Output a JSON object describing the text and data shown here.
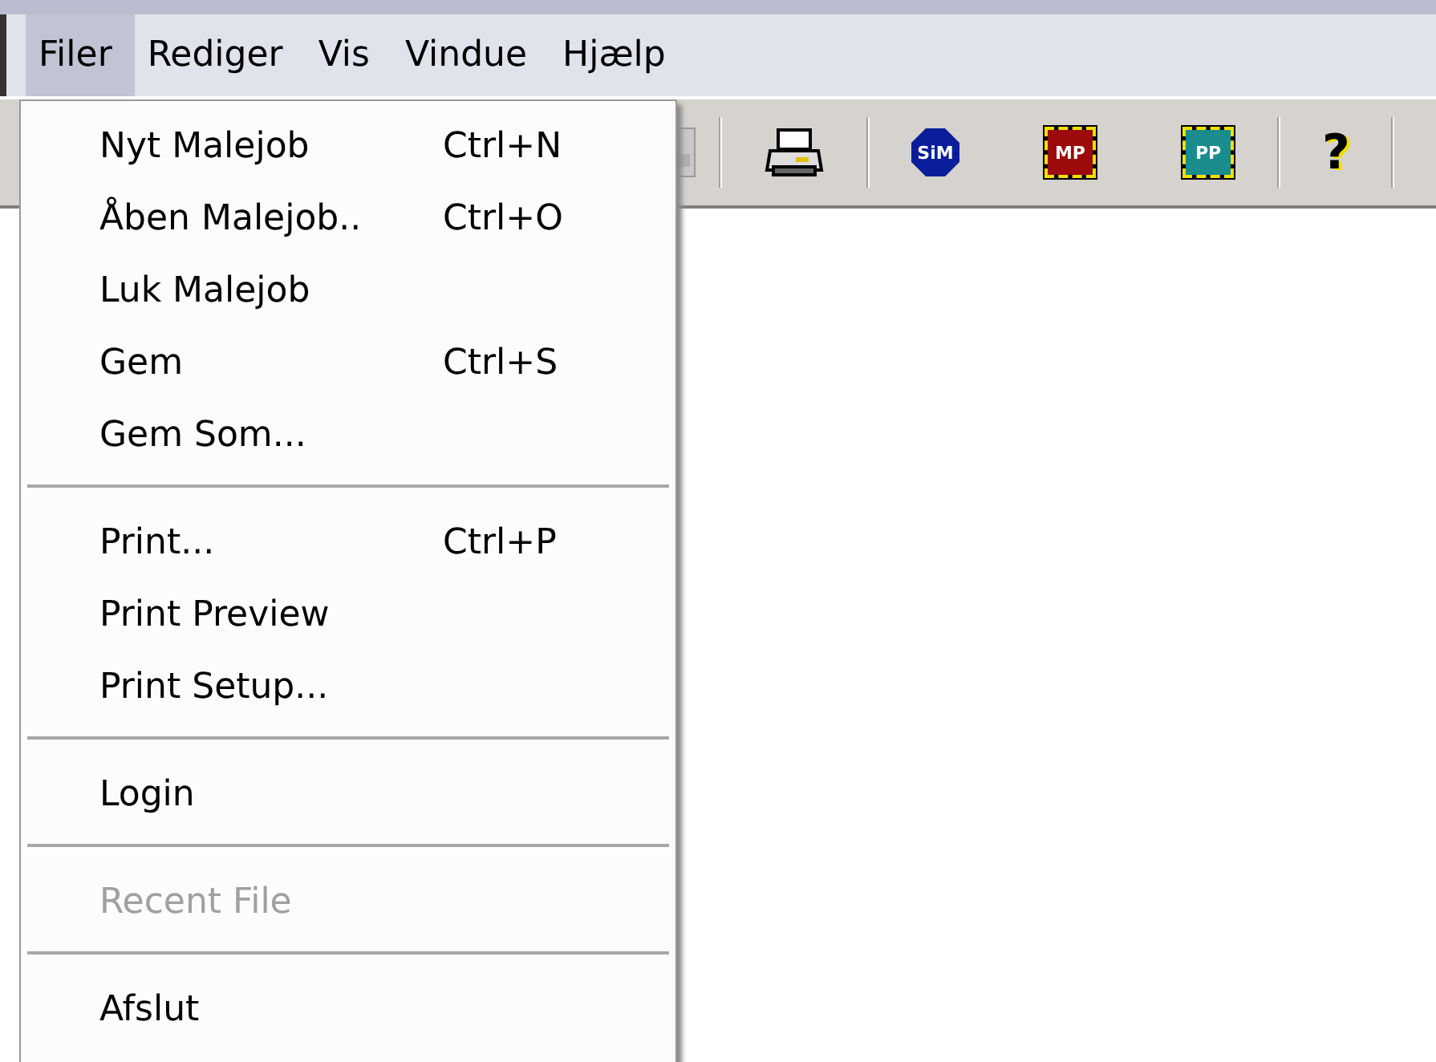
{
  "menubar": {
    "items": [
      {
        "label": "Filer",
        "selected": true
      },
      {
        "label": "Rediger",
        "selected": false
      },
      {
        "label": "Vis",
        "selected": false
      },
      {
        "label": "Vindue",
        "selected": false
      },
      {
        "label": "Hjælp",
        "selected": false
      }
    ]
  },
  "toolbar": {
    "buttons": [
      {
        "kind": "disabled-doc"
      },
      {
        "kind": "separator"
      },
      {
        "kind": "printer"
      },
      {
        "kind": "separator"
      },
      {
        "kind": "octagon",
        "label": "SiM"
      },
      {
        "kind": "square",
        "label": "MP",
        "color": "#9c0a0a"
      },
      {
        "kind": "square",
        "label": "PP",
        "color": "#1a8c8c"
      },
      {
        "kind": "separator"
      },
      {
        "kind": "help",
        "label": "?"
      },
      {
        "kind": "separator"
      }
    ]
  },
  "menu": {
    "items": [
      {
        "kind": "item",
        "label": "Nyt Malejob",
        "shortcut": "Ctrl+N",
        "disabled": false
      },
      {
        "kind": "item",
        "label": "Åben Malejob..",
        "shortcut": "Ctrl+O",
        "disabled": false
      },
      {
        "kind": "item",
        "label": "Luk Malejob",
        "disabled": false
      },
      {
        "kind": "item",
        "label": "Gem",
        "shortcut": "Ctrl+S",
        "disabled": false
      },
      {
        "kind": "item",
        "label": "Gem Som...",
        "disabled": false
      },
      {
        "kind": "separator"
      },
      {
        "kind": "item",
        "label": "Print...",
        "shortcut": "Ctrl+P",
        "disabled": false
      },
      {
        "kind": "item",
        "label": "Print Preview",
        "disabled": false
      },
      {
        "kind": "item",
        "label": "Print Setup...",
        "disabled": false
      },
      {
        "kind": "separator"
      },
      {
        "kind": "item",
        "label": "Login",
        "disabled": false
      },
      {
        "kind": "separator"
      },
      {
        "kind": "item",
        "label": "Recent File",
        "disabled": true
      },
      {
        "kind": "separator"
      },
      {
        "kind": "item",
        "label": "Afslut",
        "disabled": false
      }
    ]
  }
}
